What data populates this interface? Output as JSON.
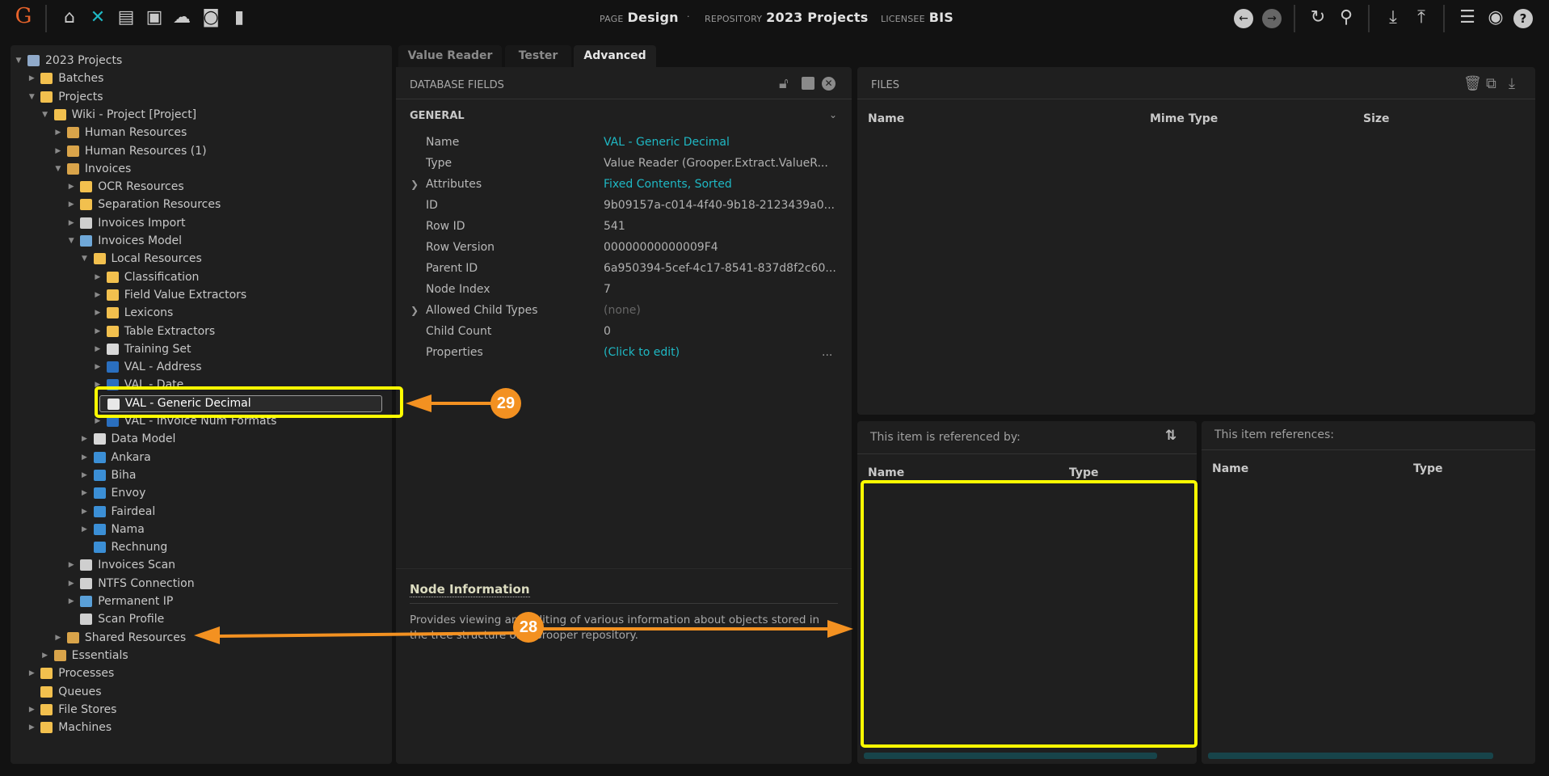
{
  "topbar": {
    "logo": "G",
    "nav_icons": [
      "home-icon",
      "tools-icon",
      "archive-icon",
      "play-box-icon",
      "cloud-upload-icon",
      "briefcase-clock-icon",
      "bar-chart-icon"
    ],
    "page_label": "PAGE",
    "page_value": "Design",
    "repository_label": "REPOSITORY",
    "repository_value": "2023 Projects",
    "licensee_label": "LICENSEE",
    "licensee_value": "BIS",
    "separator": "·"
  },
  "tree": {
    "rows": [
      {
        "label": "2023 Projects",
        "level": 0,
        "arrow": "down",
        "icon": "repository"
      },
      {
        "label": "Batches",
        "level": 1,
        "arrow": "right",
        "icon": "folder"
      },
      {
        "label": "Projects",
        "level": 1,
        "arrow": "down",
        "icon": "folder"
      },
      {
        "label": "Wiki - Project [Project]",
        "level": 2,
        "arrow": "down",
        "icon": "folder"
      },
      {
        "label": "Human Resources",
        "level": 3,
        "arrow": "right",
        "icon": "package"
      },
      {
        "label": "Human Resources (1)",
        "level": 3,
        "arrow": "right",
        "icon": "package"
      },
      {
        "label": "Invoices",
        "level": 3,
        "arrow": "down",
        "icon": "package"
      },
      {
        "label": "OCR Resources",
        "level": 4,
        "arrow": "right",
        "icon": "folder"
      },
      {
        "label": "Separation Resources",
        "level": 4,
        "arrow": "right",
        "icon": "folder"
      },
      {
        "label": "Invoices Import",
        "level": 4,
        "arrow": "right",
        "icon": "gear"
      },
      {
        "label": "Invoices Model",
        "level": 4,
        "arrow": "down",
        "icon": "model"
      },
      {
        "label": "Local Resources",
        "level": 5,
        "arrow": "down",
        "icon": "folder-blue"
      },
      {
        "label": "Classification",
        "level": 6,
        "arrow": "right",
        "icon": "folder"
      },
      {
        "label": "Field Value Extractors",
        "level": 6,
        "arrow": "right",
        "icon": "folder"
      },
      {
        "label": "Lexicons",
        "level": 6,
        "arrow": "right",
        "icon": "folder"
      },
      {
        "label": "Table Extractors",
        "level": 6,
        "arrow": "right",
        "icon": "folder"
      },
      {
        "label": "Training Set",
        "level": 6,
        "arrow": "right",
        "icon": "list"
      },
      {
        "label": "VAL - Address",
        "level": 6,
        "arrow": "right",
        "icon": "value-reader"
      },
      {
        "label": "VAL - Date",
        "level": 6,
        "arrow": "right",
        "icon": "value-reader"
      },
      {
        "label": "VAL - Generic Decimal",
        "level": 6,
        "arrow": "none",
        "icon": "document-search",
        "selected": true
      },
      {
        "label": "VAL - Invoice Num Formats",
        "level": 6,
        "arrow": "right",
        "icon": "value-reader"
      },
      {
        "label": "Data Model",
        "level": 5,
        "arrow": "right",
        "icon": "list"
      },
      {
        "label": "Ankara",
        "level": 5,
        "arrow": "right",
        "icon": "doc-type"
      },
      {
        "label": "Biha",
        "level": 5,
        "arrow": "right",
        "icon": "doc-type"
      },
      {
        "label": "Envoy",
        "level": 5,
        "arrow": "right",
        "icon": "doc-type"
      },
      {
        "label": "Fairdeal",
        "level": 5,
        "arrow": "right",
        "icon": "doc-type"
      },
      {
        "label": "Nama",
        "level": 5,
        "arrow": "right",
        "icon": "doc-type"
      },
      {
        "label": "Rechnung",
        "level": 5,
        "arrow": "none",
        "icon": "doc-type"
      },
      {
        "label": "Invoices Scan",
        "level": 4,
        "arrow": "right",
        "icon": "gear"
      },
      {
        "label": "NTFS Connection",
        "level": 4,
        "arrow": "right",
        "icon": "connection"
      },
      {
        "label": "Permanent IP",
        "level": 4,
        "arrow": "right",
        "icon": "edit"
      },
      {
        "label": "Scan Profile",
        "level": 4,
        "arrow": "none",
        "icon": "scanner"
      },
      {
        "label": "Shared Resources",
        "level": 3,
        "arrow": "right",
        "icon": "package"
      },
      {
        "label": "Essentials",
        "level": 2,
        "arrow": "right",
        "icon": "package"
      },
      {
        "label": "Processes",
        "level": 1,
        "arrow": "right",
        "icon": "folder"
      },
      {
        "label": "Queues",
        "level": 1,
        "arrow": "none",
        "icon": "folder"
      },
      {
        "label": "File Stores",
        "level": 1,
        "arrow": "right",
        "icon": "folder"
      },
      {
        "label": "Machines",
        "level": 1,
        "arrow": "right",
        "icon": "folder"
      }
    ]
  },
  "tabs": [
    {
      "label": "Value Reader",
      "active": false
    },
    {
      "label": "Tester",
      "active": false
    },
    {
      "label": "Advanced",
      "active": true
    }
  ],
  "db_fields": {
    "title": "DATABASE FIELDS",
    "section": "GENERAL",
    "rows": [
      {
        "label": "Name",
        "value": "VAL - Generic Decimal",
        "style": "teal"
      },
      {
        "label": "Type",
        "value": "Value Reader (Grooper.Extract.ValueR..."
      },
      {
        "label": "Attributes",
        "value": "Fixed Contents, Sorted",
        "style": "teal",
        "expandable": true
      },
      {
        "label": "ID",
        "value": "9b09157a-c014-4f40-9b18-2123439a0..."
      },
      {
        "label": "Row ID",
        "value": "541"
      },
      {
        "label": "Row Version",
        "value": "00000000000009F4"
      },
      {
        "label": "Parent ID",
        "value": "6a950394-5cef-4c17-8541-837d8f2c60..."
      },
      {
        "label": "Node Index",
        "value": "7"
      },
      {
        "label": "Allowed Child Types",
        "value": "(none)",
        "style": "dim",
        "expandable": true
      },
      {
        "label": "Child Count",
        "value": "0"
      },
      {
        "label": "Properties",
        "value": "(Click to edit)",
        "style": "teal",
        "ellipsis": "..."
      }
    ],
    "info_title": "Node Information",
    "info_text": "Provides viewing and editing of various information about objects stored in the tree structure of a Grooper repository."
  },
  "files": {
    "title": "FILES",
    "columns": [
      "Name",
      "Mime Type",
      "Size"
    ]
  },
  "referenced_by": {
    "title": "This item is referenced by:",
    "columns": [
      "Name",
      "Type"
    ]
  },
  "references": {
    "title": "This item references:",
    "columns": [
      "Name",
      "Type"
    ]
  },
  "annotations": {
    "badge_28": "28",
    "badge_29": "29"
  },
  "colors": {
    "accent": "#1fb8c4",
    "highlight": "#ffff00",
    "annotation": "#f39121",
    "scrollbar": "#17444a"
  }
}
